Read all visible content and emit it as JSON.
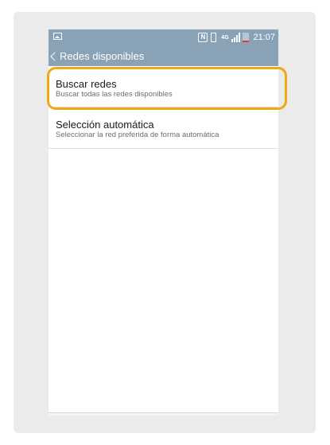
{
  "status_bar": {
    "time": "21:07",
    "network_label": "4G",
    "nfc_label": "N",
    "battery_level": 0.15,
    "signal_bars": 4,
    "icons": [
      "image-notification-icon",
      "nfc-icon",
      "vibrate-icon",
      "4g-icon",
      "signal-icon",
      "battery-icon"
    ]
  },
  "action_bar": {
    "title": "Redes disponibles",
    "back_icon": "chevron-left-icon"
  },
  "list": {
    "items": [
      {
        "title": "Buscar redes",
        "subtitle": "Buscar todas las redes disponibles",
        "highlighted": true
      },
      {
        "title": "Selección automática",
        "subtitle": "Seleccionar la red preferida de forma automática",
        "highlighted": false
      }
    ]
  },
  "highlight_color": "#f1a814",
  "header_color": "#8aa2b6",
  "nav_bar": {
    "icons": [
      "back-icon",
      "home-icon",
      "recent-apps-icon"
    ]
  }
}
